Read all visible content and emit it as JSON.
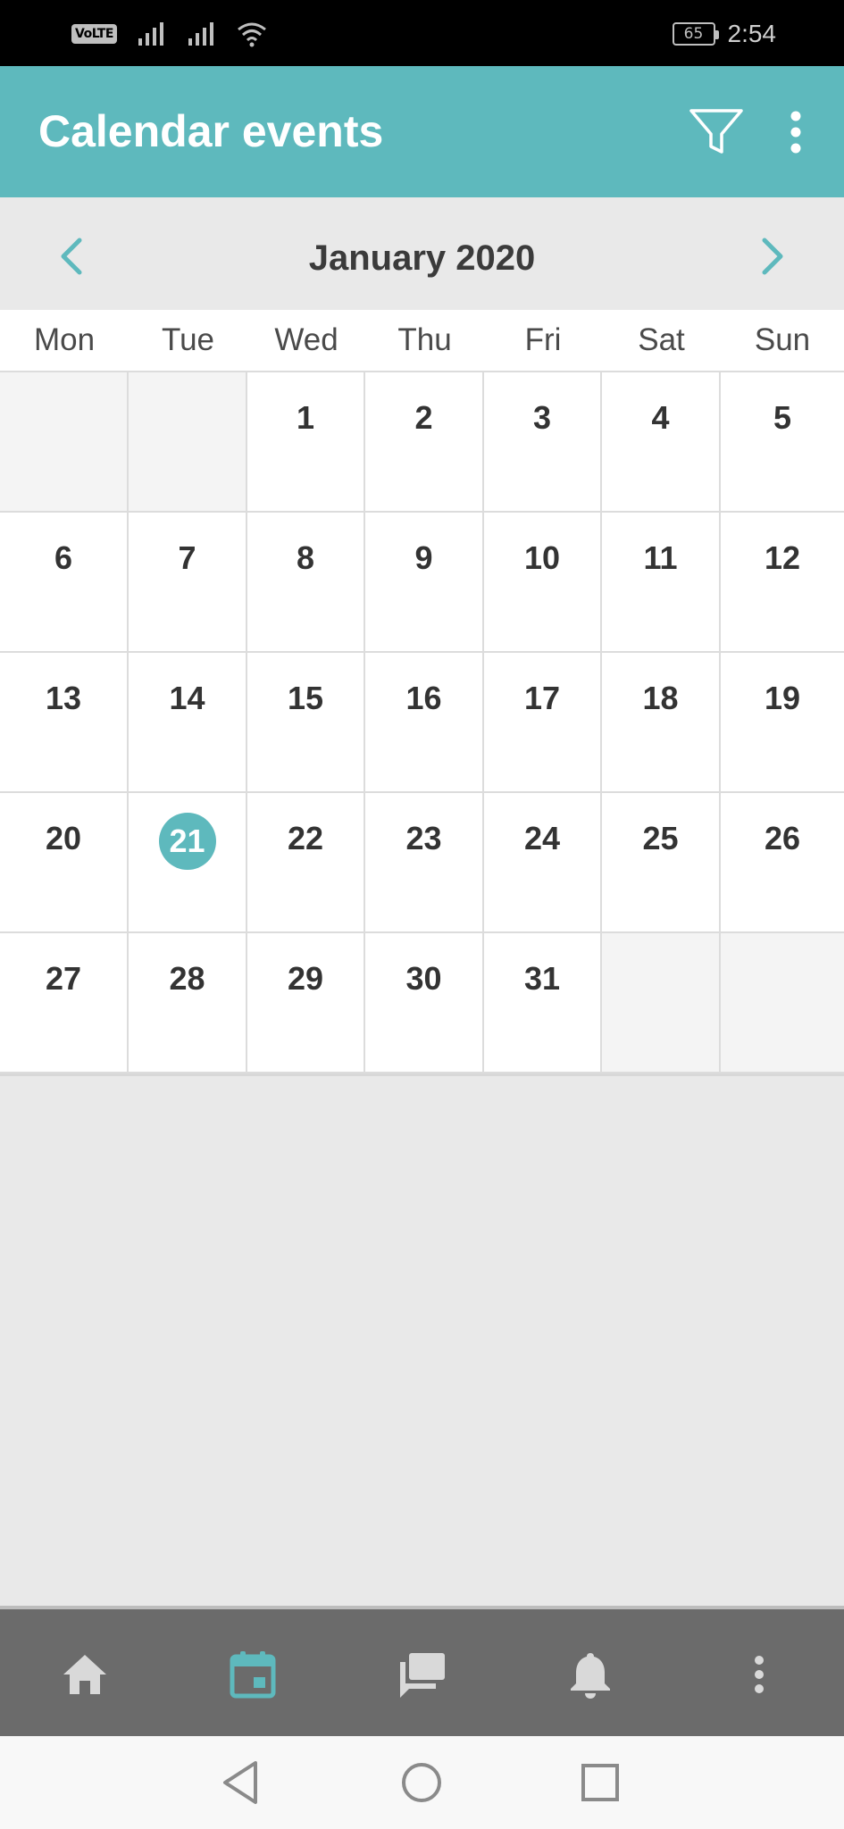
{
  "status_bar": {
    "volte": "VoLTE",
    "battery": "65",
    "time": "2:54"
  },
  "app_bar": {
    "title": "Calendar events",
    "filter_icon": "filter-icon",
    "more_icon": "more-vert-icon"
  },
  "calendar": {
    "month_label": "January 2020",
    "prev_icon": "chevron-left-icon",
    "next_icon": "chevron-right-icon",
    "weekdays": [
      "Mon",
      "Tue",
      "Wed",
      "Thu",
      "Fri",
      "Sat",
      "Sun"
    ],
    "days": [
      "",
      "",
      "1",
      "2",
      "3",
      "4",
      "5",
      "6",
      "7",
      "8",
      "9",
      "10",
      "11",
      "12",
      "13",
      "14",
      "15",
      "16",
      "17",
      "18",
      "19",
      "20",
      "21",
      "22",
      "23",
      "24",
      "25",
      "26",
      "27",
      "28",
      "29",
      "30",
      "31",
      "",
      ""
    ],
    "today": "21"
  },
  "bottom_nav": {
    "items": [
      {
        "icon": "home-icon",
        "active": false
      },
      {
        "icon": "calendar-icon",
        "active": true
      },
      {
        "icon": "chat-icon",
        "active": false
      },
      {
        "icon": "bell-icon",
        "active": false
      },
      {
        "icon": "more-vert-icon",
        "active": false
      }
    ]
  },
  "colors": {
    "accent": "#5eb9bd",
    "nav_bg": "#6b6b6b",
    "nav_icon": "#d9d9d9"
  }
}
